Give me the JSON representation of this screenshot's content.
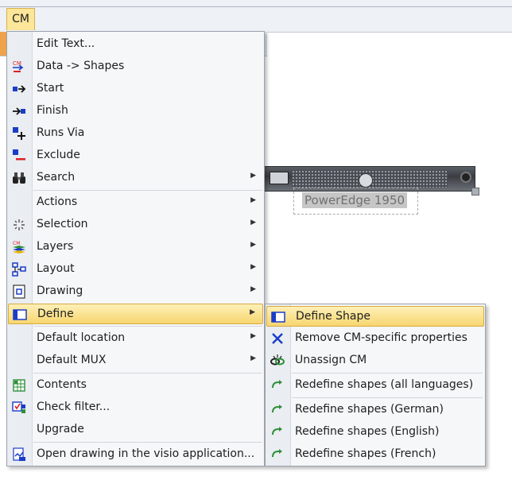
{
  "menubar": {
    "cm_tab": "CM"
  },
  "canvas": {
    "device_label": "PowerEdge 1950"
  },
  "main_menu": {
    "items": [
      {
        "label": "Edit Text...",
        "icon": "none"
      },
      {
        "label": "Data -> Shapes",
        "icon": "data-to-shapes-icon"
      },
      {
        "label": "Start",
        "icon": "start-arrow-icon"
      },
      {
        "label": "Finish",
        "icon": "finish-arrow-icon"
      },
      {
        "label": "Runs Via",
        "icon": "runs-via-plus-icon"
      },
      {
        "label": "Exclude",
        "icon": "exclude-minus-icon"
      },
      {
        "label": "Search",
        "icon": "binoculars-icon",
        "submenu": true
      },
      {
        "label": "Actions",
        "icon": "none",
        "submenu": true
      },
      {
        "label": "Selection",
        "icon": "selection-sparkle-icon",
        "submenu": true
      },
      {
        "label": "Layers",
        "icon": "layers-icon",
        "submenu": true
      },
      {
        "label": "Layout",
        "icon": "layout-tree-icon",
        "submenu": true
      },
      {
        "label": "Drawing",
        "icon": "drawing-page-icon",
        "submenu": true
      },
      {
        "label": "Define",
        "icon": "define-shape-icon",
        "submenu": true,
        "highlighted": true
      },
      {
        "label": "Default location",
        "icon": "none",
        "submenu": true
      },
      {
        "label": "Default MUX",
        "icon": "none",
        "submenu": true
      },
      {
        "label": "Contents",
        "icon": "contents-grid-icon"
      },
      {
        "label": "Check filter...",
        "icon": "check-filter-icon"
      },
      {
        "label": "Upgrade",
        "icon": "none"
      },
      {
        "label": "Open drawing in the visio application...",
        "icon": "open-visio-icon"
      }
    ]
  },
  "define_submenu": {
    "items": [
      {
        "label": "Define Shape",
        "icon": "define-shape-icon",
        "highlighted": true
      },
      {
        "label": "Remove CM-specific properties",
        "icon": "remove-x-icon"
      },
      {
        "label": "Unassign CM",
        "icon": "unassign-link-icon"
      },
      {
        "label": "Redefine shapes (all languages)",
        "icon": "redefine-arrow-icon"
      },
      {
        "label": "Redefine shapes (German)",
        "icon": "redefine-arrow-icon"
      },
      {
        "label": "Redefine shapes (English)",
        "icon": "redefine-arrow-icon"
      },
      {
        "label": "Redefine shapes (French)",
        "icon": "redefine-arrow-icon"
      }
    ]
  },
  "colors": {
    "highlight_top": "#fdf0b8",
    "highlight_bottom": "#f7d66f",
    "icon_blue": "#1a3cc8",
    "icon_red": "#d8232a",
    "icon_green": "#2f8f3a"
  }
}
